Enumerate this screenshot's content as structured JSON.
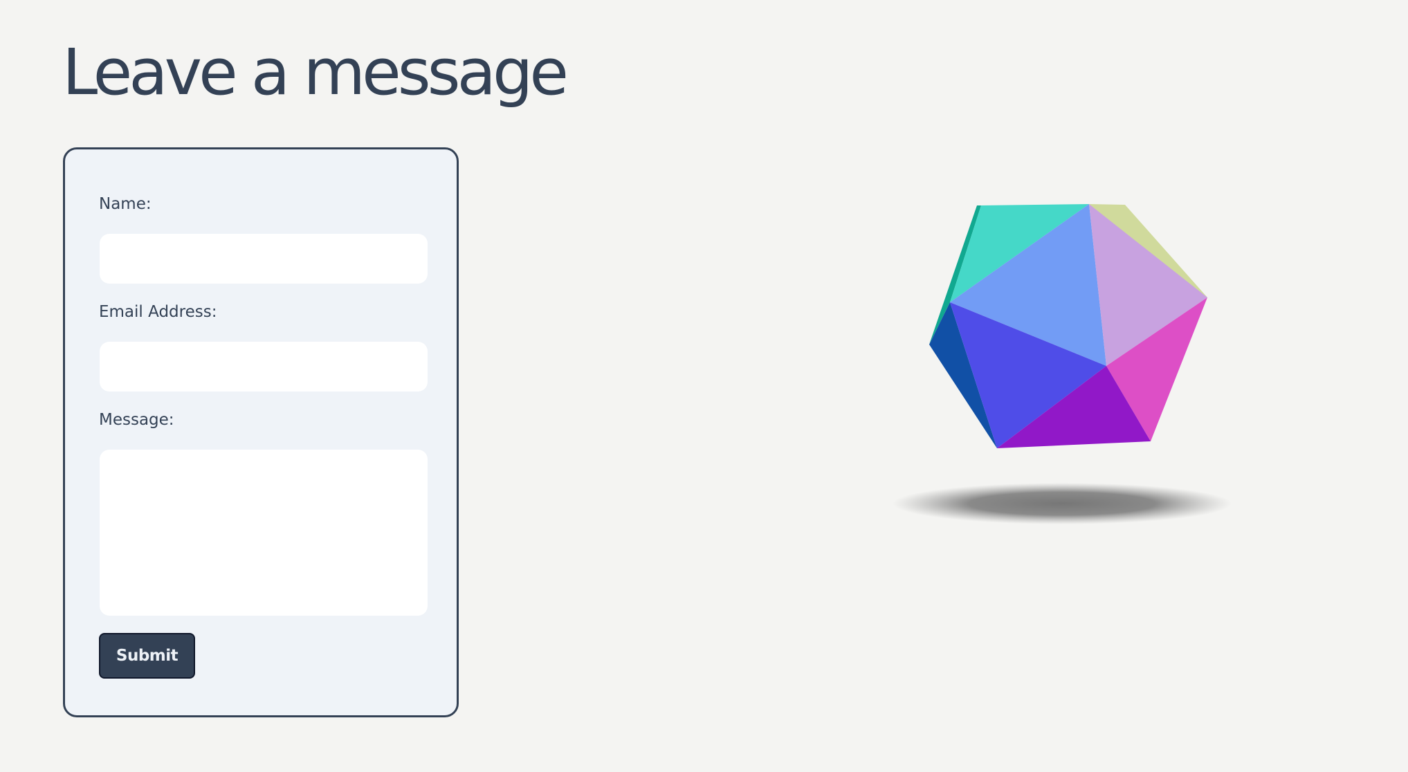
{
  "page": {
    "title": "Leave a message"
  },
  "form": {
    "name_label": "Name:",
    "name_value": "",
    "email_label": "Email Address:",
    "email_value": "",
    "message_label": "Message:",
    "message_value": "",
    "submit_label": "Submit"
  },
  "decoration": {
    "icon": "icosahedron-3d-graphic",
    "colors": {
      "teal_face": "#45d8c8",
      "blue_face": "#729cf5",
      "lilac_face": "#c8a2e0",
      "olive_face": "#d0da9c",
      "pink_face": "#dd4fc6",
      "indigo_face": "#4f4de8",
      "purple_face": "#9118c8",
      "navy_face": "#1150a6",
      "green_face": "#11a890",
      "shadow": "#707070"
    }
  }
}
